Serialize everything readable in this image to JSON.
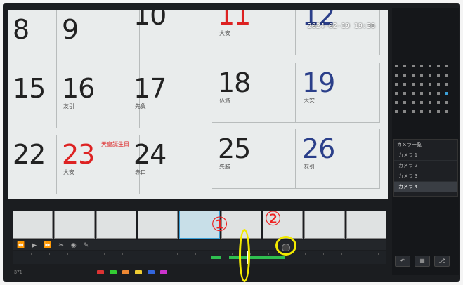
{
  "calendar": {
    "row1": [
      {
        "day": "8",
        "sub": ""
      },
      {
        "day": "9",
        "sub": ""
      },
      {
        "day": "10",
        "sub": ""
      },
      {
        "day": "11",
        "sub": "大安"
      },
      {
        "day": "12",
        "sub": ""
      }
    ],
    "row2": [
      {
        "day": "15",
        "sub": ""
      },
      {
        "day": "16",
        "sub": "友引"
      },
      {
        "day": "17",
        "sub": "先負"
      },
      {
        "day": "18",
        "sub": "仏滅"
      },
      {
        "day": "19",
        "sub": "大安"
      }
    ],
    "row3": [
      {
        "day": "22",
        "sub": ""
      },
      {
        "day": "23",
        "sub": "大安"
      },
      {
        "day": "24",
        "sub": "赤口"
      },
      {
        "day": "25",
        "sub": "先勝"
      },
      {
        "day": "26",
        "sub": "友引"
      }
    ],
    "holiday_label": "天皇誕生日"
  },
  "overlay": {
    "timestamp": "2024-02-19 19:36"
  },
  "sidebar": {
    "panel_title": "カメラ一覧",
    "cameras": [
      "カメラ 1",
      "カメラ 2",
      "カメラ 3",
      "カメラ 4"
    ],
    "selected_index": 3
  },
  "bottom": {
    "left_text": "371"
  },
  "annotations": {
    "marker1": "①",
    "marker2": "②"
  },
  "colors": {
    "annotation_red": "#e22222",
    "highlight_yellow": "#f2ea00",
    "record_green": "#2fbf50",
    "selected_blue": "#3b9fd6"
  }
}
